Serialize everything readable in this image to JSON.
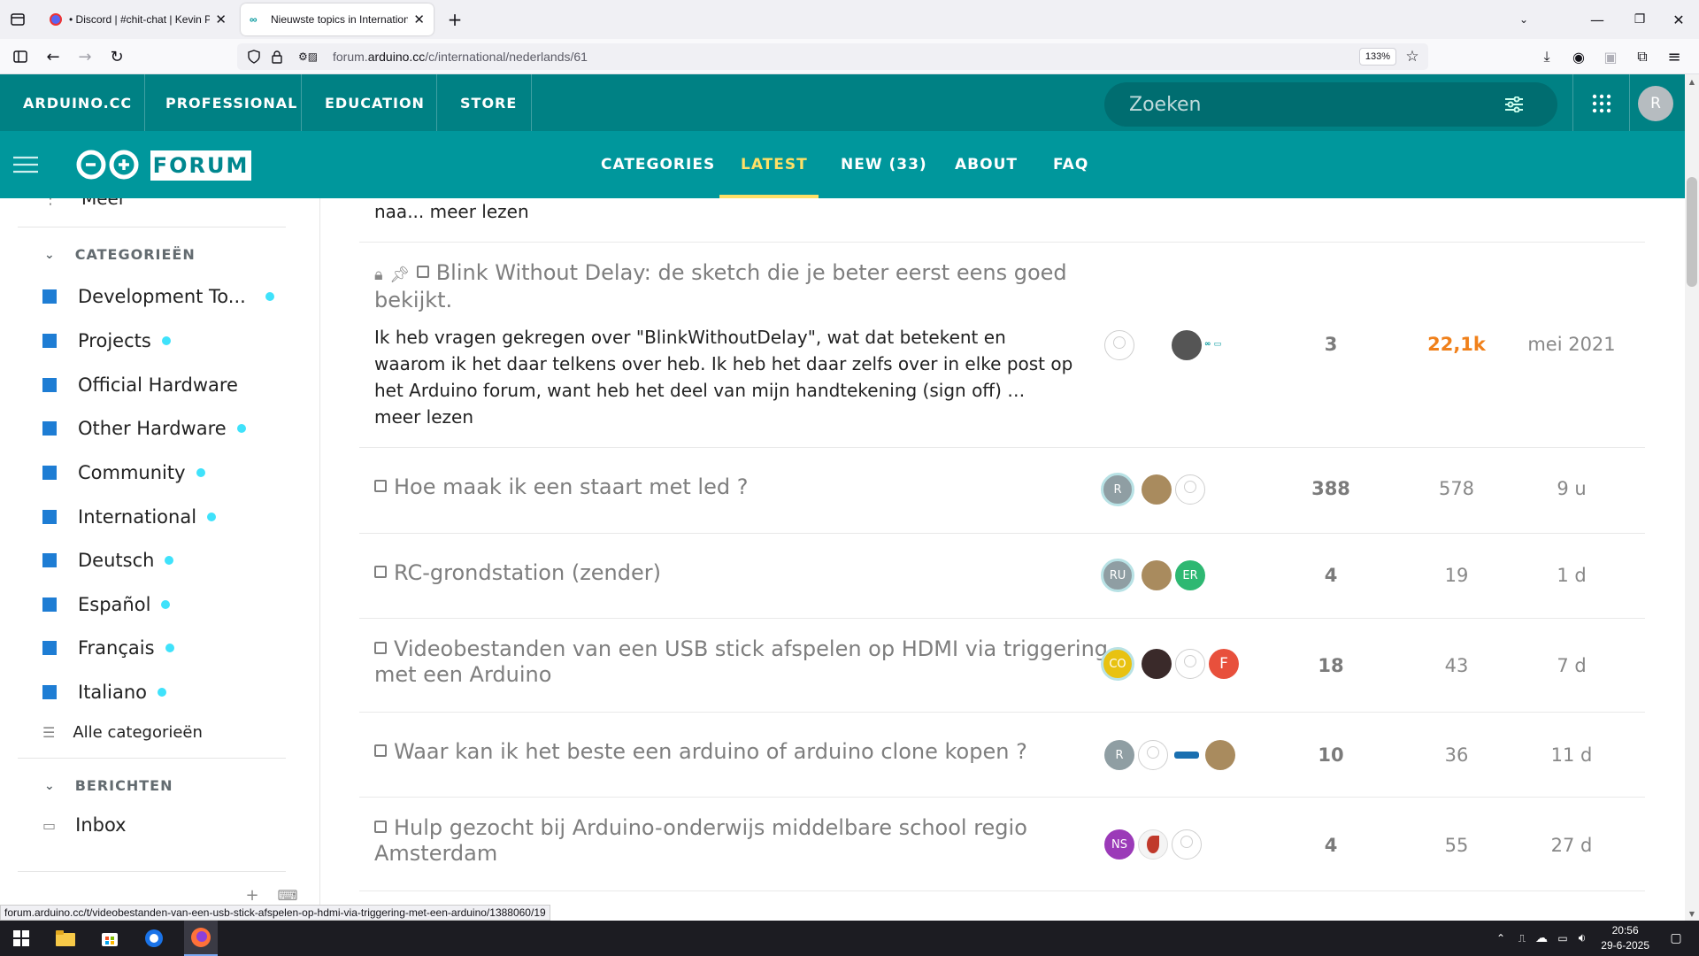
{
  "browser": {
    "tabs": [
      {
        "title": "• Discord | #chit-chat | Kevin Po",
        "active": false
      },
      {
        "title": "Nieuwste topics in International",
        "active": true
      }
    ],
    "url_prefix": "forum.",
    "url_domain": "arduino.cc",
    "url_path": "/c/international/nederlands/61",
    "zoom": "133%"
  },
  "topnav": {
    "items": [
      "ARDUINO.CC",
      "PROFESSIONAL",
      "EDUCATION",
      "STORE"
    ],
    "search_placeholder": "Zoeken",
    "user_initial": "R"
  },
  "forumnav": {
    "logo_text": "FORUM",
    "links": [
      "CATEGORIES",
      "LATEST",
      "NEW (33)",
      "ABOUT",
      "FAQ"
    ],
    "active": "LATEST"
  },
  "sidebar": {
    "more_label": "Meer",
    "categories_heading": "CATEGORIEËN",
    "categories": [
      {
        "name": "Development To...",
        "unread": true
      },
      {
        "name": "Projects",
        "unread": true
      },
      {
        "name": "Official Hardware",
        "unread": false
      },
      {
        "name": "Other Hardware",
        "unread": true
      },
      {
        "name": "Community",
        "unread": true
      },
      {
        "name": "International",
        "unread": true
      },
      {
        "name": "Deutsch",
        "unread": true
      },
      {
        "name": "Español",
        "unread": true
      },
      {
        "name": "Français",
        "unread": true
      },
      {
        "name": "Italiano",
        "unread": true
      }
    ],
    "all_categories": "Alle categorieën",
    "messages_heading": "BERICHTEN",
    "inbox": "Inbox"
  },
  "topics": {
    "prev_excerpt_tail": "naa... meer lezen",
    "rows": [
      {
        "title_line1": "Blink Without Delay: de sketch die je beter eerst eens goed",
        "title_line2": "bekijkt.",
        "excerpt": "Ik heb vragen gekregen over \"BlinkWithoutDelay\", wat dat betekent en waarom ik het daar telkens over heb. Ik heb het daar zelfs over in elke post op het Arduino forum, want heb het deel van mijn handtekening (sign off) …",
        "excerpt_more": "meer lezen",
        "replies": "3",
        "views": "22,1k",
        "activity": "mei 2021"
      },
      {
        "title_line1": "Hoe maak ik een staart met led ?",
        "replies": "388",
        "views": "578",
        "activity": "9 u",
        "avatars": [
          "R",
          "",
          ""
        ]
      },
      {
        "title_line1": "RC-grondstation (zender)",
        "replies": "4",
        "views": "19",
        "activity": "1 d",
        "avatars": [
          "RU",
          "",
          "ER"
        ]
      },
      {
        "title_line1": "Videobestanden van een USB stick afspelen op HDMI via triggering",
        "title_line2": "met een Arduino",
        "replies": "18",
        "views": "43",
        "activity": "7 d",
        "avatars": [
          "CO",
          "",
          "",
          "F"
        ]
      },
      {
        "title_line1": "Waar kan ik het beste een arduino of arduino clone kopen ?",
        "replies": "10",
        "views": "36",
        "activity": "11 d",
        "avatars": [
          "R",
          "",
          "",
          ""
        ]
      },
      {
        "title_line1": "Hulp gezocht bij Arduino-onderwijs middelbare school regio",
        "title_line2": "Amsterdam",
        "replies": "4",
        "views": "55",
        "activity": "27 d",
        "avatars": [
          "NS",
          "",
          ""
        ]
      }
    ]
  },
  "status_url": "forum.arduino.cc/t/videobestanden-van-een-usb-stick-afspelen-op-hdmi-via-triggering-met-een-arduino/1388060/19",
  "taskbar": {
    "time": "20:56",
    "date": "29-6-2025"
  },
  "colors": {
    "teal_dark": "#008184",
    "teal": "#00979c",
    "accent_yellow": "#ffe066",
    "hot_views": "#f0801a",
    "category_blue": "#1e7dd4",
    "unread_dot": "#3fe2fb"
  }
}
